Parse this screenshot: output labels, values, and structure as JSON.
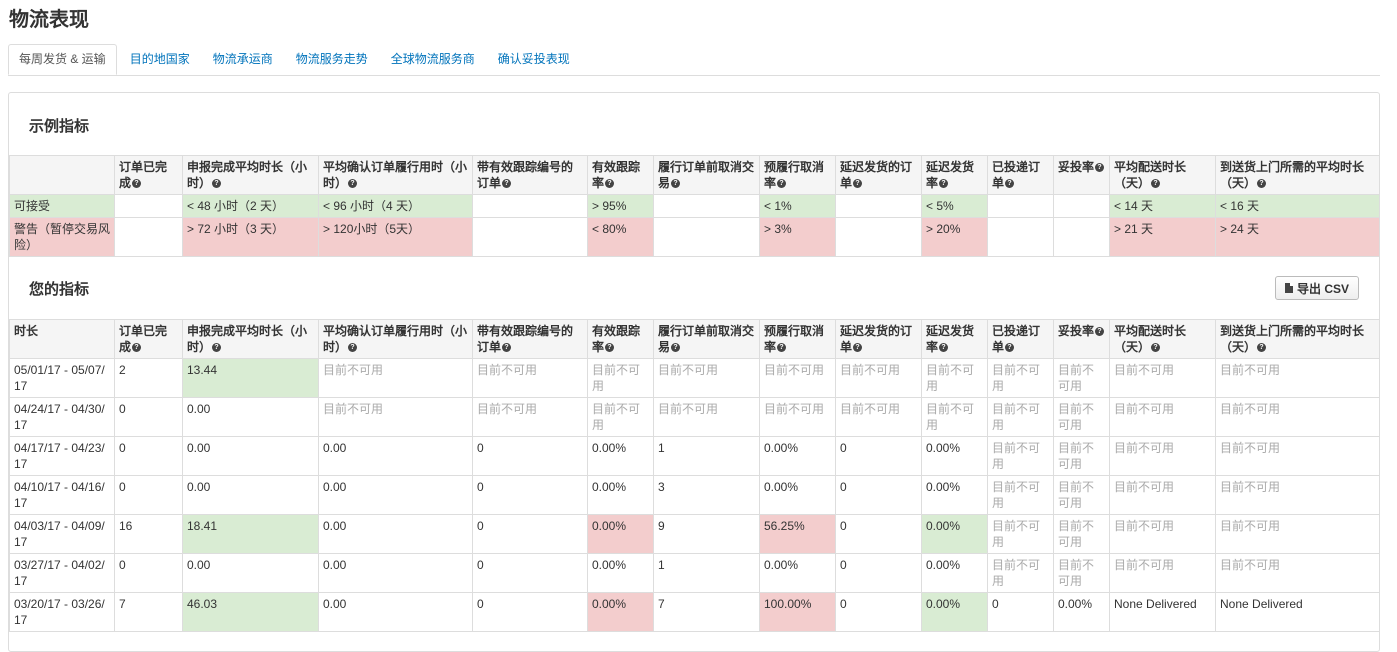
{
  "page": {
    "title": "物流表现"
  },
  "tabs": [
    {
      "label": "每周发货 & 运输",
      "active": true
    },
    {
      "label": "目的地国家"
    },
    {
      "label": "物流承运商"
    },
    {
      "label": "物流服务走势"
    },
    {
      "label": "全球物流服务商"
    },
    {
      "label": "确认妥投表现"
    }
  ],
  "sample": {
    "title": "示例指标",
    "headers": [
      "",
      "订单已完成",
      "申报完成平均时长（小时）",
      "平均确认订单履行用时（小时）",
      "带有效跟踪编号的订单",
      "有效跟踪率",
      "履行订单前取消交易",
      "预履行取消率",
      "延迟发货的订单",
      "延迟发货率",
      "已投递订单",
      "妥投率",
      "平均配送时长（天）",
      "到送货上门所需的平均时长（天）"
    ],
    "rows": [
      {
        "cells": [
          "可接受",
          "",
          "< 48 小时（2 天）",
          "< 96 小时（4 天）",
          "",
          "> 95%",
          "",
          "< 1%",
          "",
          "< 5%",
          "",
          "",
          "< 14 天",
          "< 16 天"
        ],
        "status": "good"
      },
      {
        "cells": [
          "警告（暂停交易风险）",
          "",
          "> 72 小时（3 天）",
          "> 120小时（5天）",
          "",
          "< 80%",
          "",
          "> 3%",
          "",
          "> 20%",
          "",
          "",
          "> 21 天",
          "> 24 天"
        ],
        "status": "bad"
      }
    ]
  },
  "mine": {
    "title": "您的指标",
    "export_label": "导出 CSV",
    "headers": [
      "时长",
      "订单已完成",
      "申报完成平均时长（小时）",
      "平均确认订单履行用时（小时）",
      "带有效跟踪编号的订单",
      "有效跟踪率",
      "履行订单前取消交易",
      "预履行取消率",
      "延迟发货的订单",
      "延迟发货率",
      "已投递订单",
      "妥投率",
      "平均配送时长（天）",
      "到送货上门所需的平均时长（天）"
    ],
    "na_text": "目前不可用",
    "rows": [
      [
        "05/01/17 - 05/07/17",
        "2",
        "13.44",
        "NA",
        "NA",
        "NA",
        "NA",
        "NA",
        "NA",
        "NA",
        "NA",
        "NA",
        "NA",
        "NA"
      ],
      [
        "04/24/17 - 04/30/17",
        "0",
        "0.00",
        "NA",
        "NA",
        "NA",
        "NA",
        "NA",
        "NA",
        "NA",
        "NA",
        "NA",
        "NA",
        "NA"
      ],
      [
        "04/17/17 - 04/23/17",
        "0",
        "0.00",
        "0.00",
        "0",
        "0.00%",
        "1",
        "0.00%",
        "0",
        "0.00%",
        "NA",
        "NA",
        "NA",
        "NA"
      ],
      [
        "04/10/17 - 04/16/17",
        "0",
        "0.00",
        "0.00",
        "0",
        "0.00%",
        "3",
        "0.00%",
        "0",
        "0.00%",
        "NA",
        "NA",
        "NA",
        "NA"
      ],
      [
        "04/03/17 - 04/09/17",
        "16",
        "18.41",
        "0.00",
        "0",
        "0.00%",
        "9",
        "56.25%",
        "0",
        "0.00%",
        "NA",
        "NA",
        "NA",
        "NA"
      ],
      [
        "03/27/17 - 04/02/17",
        "0",
        "0.00",
        "0.00",
        "0",
        "0.00%",
        "1",
        "0.00%",
        "0",
        "0.00%",
        "NA",
        "NA",
        "NA",
        "NA"
      ],
      [
        "03/20/17 - 03/26/17",
        "7",
        "46.03",
        "0.00",
        "0",
        "0.00%",
        "7",
        "100.00%",
        "0",
        "0.00%",
        "0",
        "0.00%",
        "None Delivered",
        "None Delivered"
      ]
    ],
    "highlights": [
      {
        "row": 0,
        "col": 2,
        "status": "good"
      },
      {
        "row": 4,
        "col": 2,
        "status": "good"
      },
      {
        "row": 4,
        "col": 5,
        "status": "bad"
      },
      {
        "row": 4,
        "col": 7,
        "status": "bad"
      },
      {
        "row": 4,
        "col": 9,
        "status": "good"
      },
      {
        "row": 6,
        "col": 2,
        "status": "good"
      },
      {
        "row": 6,
        "col": 5,
        "status": "bad"
      },
      {
        "row": 6,
        "col": 7,
        "status": "bad"
      },
      {
        "row": 6,
        "col": 9,
        "status": "good"
      }
    ]
  }
}
